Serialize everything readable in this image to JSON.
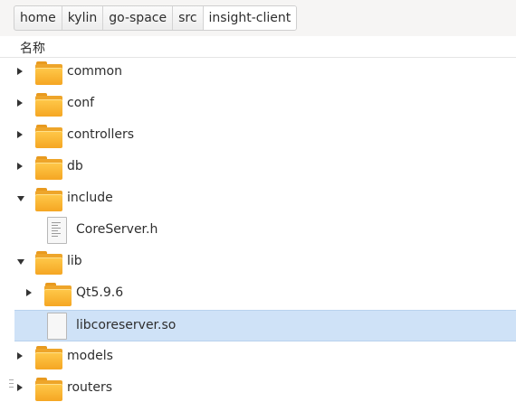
{
  "breadcrumb": [
    "home",
    "kylin",
    "go-space",
    "src",
    "insight-client"
  ],
  "column_header": {
    "name": "名称"
  },
  "files": [
    {
      "name": "common",
      "type": "folder",
      "depth": 0,
      "expander": "collapsed",
      "selected": false
    },
    {
      "name": "conf",
      "type": "folder",
      "depth": 0,
      "expander": "collapsed",
      "selected": false
    },
    {
      "name": "controllers",
      "type": "folder",
      "depth": 0,
      "expander": "collapsed",
      "selected": false
    },
    {
      "name": "db",
      "type": "folder",
      "depth": 0,
      "expander": "collapsed",
      "selected": false
    },
    {
      "name": "include",
      "type": "folder",
      "depth": 0,
      "expander": "expanded",
      "selected": false
    },
    {
      "name": "CoreServer.h",
      "type": "text-file",
      "depth": 1,
      "expander": "none",
      "selected": false
    },
    {
      "name": "lib",
      "type": "folder",
      "depth": 0,
      "expander": "expanded",
      "selected": false
    },
    {
      "name": "Qt5.9.6",
      "type": "folder",
      "depth": 1,
      "expander": "collapsed",
      "selected": false
    },
    {
      "name": "libcoreserver.so",
      "type": "file",
      "depth": 1,
      "expander": "none",
      "selected": true
    },
    {
      "name": "models",
      "type": "folder",
      "depth": 0,
      "expander": "collapsed",
      "selected": false
    },
    {
      "name": "routers",
      "type": "folder",
      "depth": 0,
      "expander": "collapsed",
      "selected": false
    }
  ],
  "colors": {
    "selection": "#cfe2f7",
    "folder": "#f5a623",
    "text": "#2e2e2e"
  }
}
